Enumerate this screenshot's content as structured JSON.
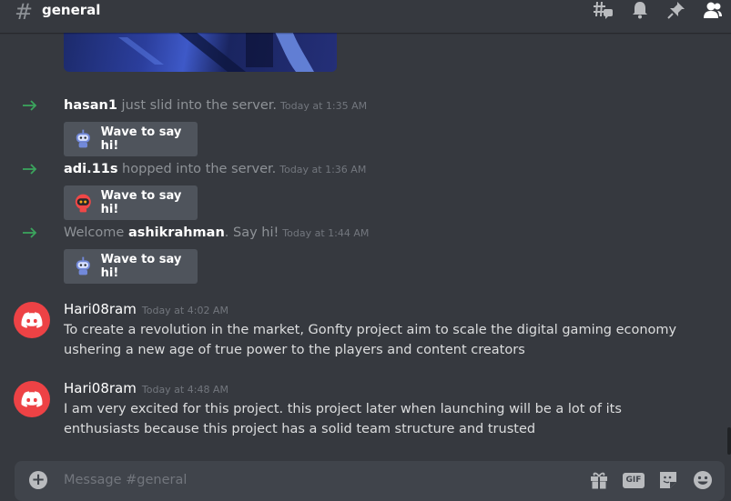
{
  "header": {
    "hash": "#",
    "channel": "general"
  },
  "joins": [
    {
      "before": "",
      "user": "hasan1",
      "after": " just slid into the server.",
      "timestamp": "Today at 1:35 AM",
      "wave_label": "Wave to say hi!",
      "sticker": "blue-robot-sticker"
    },
    {
      "before": "",
      "user": "adi.11s",
      "after": " hopped into the server.",
      "timestamp": "Today at 1:36 AM",
      "wave_label": "Wave to say hi!",
      "sticker": "red-robot-sticker"
    },
    {
      "before": "Welcome ",
      "user": "ashikrahman",
      "after": ". Say hi!",
      "timestamp": "Today at 1:44 AM",
      "wave_label": "Wave to say hi!",
      "sticker": "blue-robot-sticker"
    }
  ],
  "messages": [
    {
      "author": "Hari08ram",
      "timestamp": "Today at 4:02 AM",
      "text": "To create a revolution in the market, Gonfty project aim to scale the digital gaming economy ushering a new age of true power to the players and content creators"
    },
    {
      "author": "Hari08ram",
      "timestamp": "Today at 4:48 AM",
      "text": "I am very excited for this project. this project later when launching will be a lot of its enthusiasts because this project has a solid team structure and trusted"
    }
  ],
  "composer": {
    "placeholder": "Message #general",
    "gif_label": "GIF"
  },
  "icons": {
    "header": [
      "threads-icon",
      "bell-icon",
      "pin-icon",
      "members-icon"
    ],
    "composer": [
      "gift-icon",
      "gif-icon",
      "sticker-icon",
      "emoji-icon"
    ]
  },
  "colors": {
    "background": "#36393f",
    "join_arrow": "#3ba55d",
    "avatar": "#ed4245",
    "wave_button": "#4f545c",
    "composer": "#40444b"
  }
}
